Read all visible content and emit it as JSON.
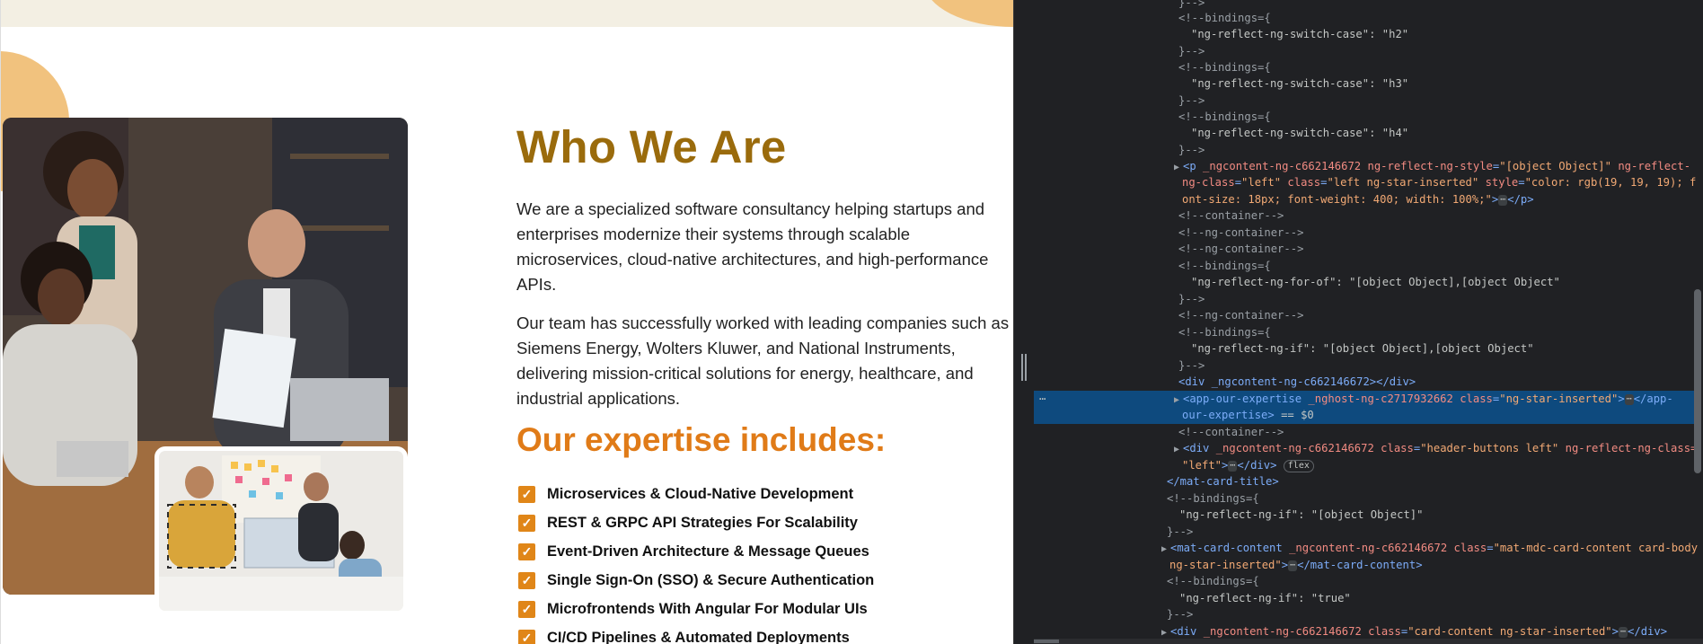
{
  "site": {
    "heading_who": "Who We Are",
    "paragraph_1": "We are a specialized software consultancy helping startups and enterprises modernize their systems through scalable microservices, cloud-native architectures, and high-performance APIs.",
    "paragraph_2": "Our team has successfully worked with leading companies such as Siemens Energy, Wolters Kluwer, and National Instruments, delivering mission-critical solutions for energy, healthcare, and industrial applications.",
    "heading_expertise": "Our expertise includes:",
    "expertise": [
      "Microservices & Cloud-Native Development",
      "REST & GRPC API Strategies For Scalability",
      "Event-Driven Architecture & Message Queues",
      "Single Sign-On (SSO) & Secure Authentication",
      "Microfrontends With Angular For Modular UIs",
      "CI/CD Pipelines & Automated Deployments"
    ],
    "check_glyph": "✓",
    "colors": {
      "heading_dark_gold": "#9a6b0c",
      "heading_orange": "#e07b18",
      "check_orange": "#e08618",
      "blob": "#f1c27e"
    },
    "images": [
      "team-meeting-photo",
      "team-whiteboard-photo"
    ]
  },
  "devtools": {
    "l1": "}-->",
    "l2": "<!--bindings={",
    "l3": "\"ng-reflect-ng-switch-case\": \"h2\"",
    "l4": "}-->",
    "l5": "<!--bindings={",
    "l6": "\"ng-reflect-ng-switch-case\": \"h3\"",
    "l7": "}-->",
    "l8": "<!--bindings={",
    "l9": "\"ng-reflect-ng-switch-case\": \"h4\"",
    "l10": "}-->",
    "p_open": "<p",
    "p_a1n": "_ngcontent-ng-c662146672",
    "p_a2n": "ng-reflect-ng-style",
    "p_a2v": "\"[object Object]\"",
    "p_a3n": "ng-reflect-",
    "p_a3n_cont": "ng-class",
    "p_a3v": "\"left\"",
    "p_a4n": "class",
    "p_a4v": "\"left ng-star-inserted\"",
    "p_a5n": "style",
    "p_a5v": "\"color: rgb(19, 19, 19); f",
    "p_a5v_cont": "ont-size: 18px; font-weight: 400; width: 100%;\"",
    "p_close": "</p>",
    "c_container": "<!--container-->",
    "c_ngcontainer1": "<!--ng-container-->",
    "c_ngcontainer2": "<!--ng-container-->",
    "b_for_open": "<!--bindings={",
    "b_for": "\"ng-reflect-ng-for-of\": \"[object Object],[object Object\"",
    "b_for_close": "}-->",
    "c_ngcontainer3": "<!--ng-container-->",
    "b_if_open": "<!--bindings={",
    "b_if": "\"ng-reflect-ng-if\": \"[object Object],[object Object\"",
    "b_if_close": "}-->",
    "div_empty": "<div _ngcontent-ng-c662146672></div>",
    "sel_open": "<app-our-expertise",
    "sel_a1n": "_nghost-ng-c2717932662",
    "sel_a2n": "class",
    "sel_a2v": "\"ng-star-inserted\"",
    "sel_close": "</app-",
    "sel_close_cont": "our-expertise>",
    "sel_eq": "== $0",
    "c_container2": "<!--container-->",
    "div_hb_open": "<div",
    "div_hb_a1n": "_ngcontent-ng-c662146672",
    "div_hb_a2n": "class",
    "div_hb_a2v": "\"header-buttons left\"",
    "div_hb_a3n": "ng-reflect-ng-class=",
    "div_hb_a3v": "\"left\"",
    "div_hb_close": "</div>",
    "flex_badge": "flex",
    "mat_title_close": "</mat-card-title>",
    "b_if2_open": "<!--bindings={",
    "b_if2": "\"ng-reflect-ng-if\": \"[object Object]\"",
    "b_if2_close": "}-->",
    "mcc_open": "<mat-card-content",
    "mcc_a1n": "_ngcontent-ng-c662146672",
    "mcc_a2n": "class",
    "mcc_a2v": "\"mat-mdc-card-content card-body",
    "mcc_a2v_cont": "ng-star-inserted\"",
    "mcc_close": "</mat-card-content>",
    "b_if3_open": "<!--bindings={",
    "b_if3": "\"ng-reflect-ng-if\": \"true\"",
    "b_if3_close": "}-->",
    "cc_open": "<div",
    "cc_a1n": "_ngcontent-ng-c662146672",
    "cc_a2n": "class",
    "cc_a2v": "\"card-content ng-star-inserted\"",
    "cc_close": "</div>",
    "dots": "⋯",
    "gutter": "⋯",
    "triangle": "▶"
  }
}
